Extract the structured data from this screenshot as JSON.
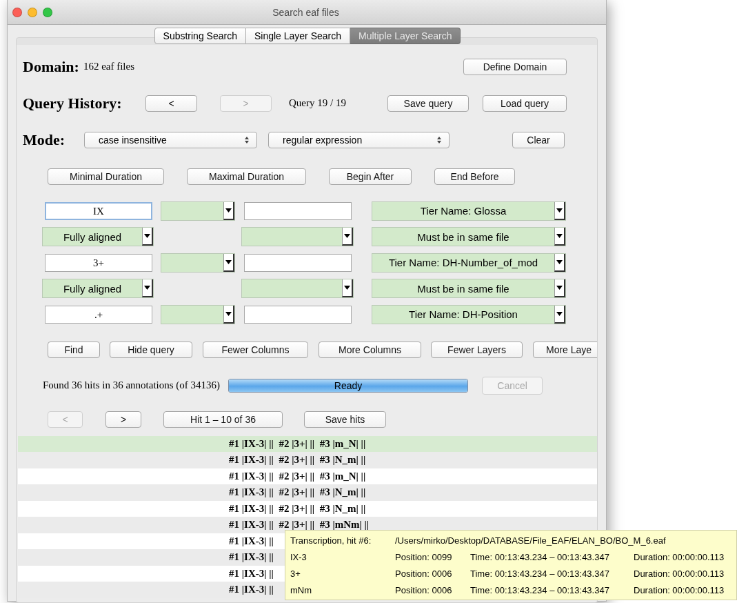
{
  "window": {
    "title": "Search eaf files"
  },
  "tabs": [
    {
      "label": "Substring Search",
      "selected": false
    },
    {
      "label": "Single Layer Search",
      "selected": false
    },
    {
      "label": "Multiple Layer Search",
      "selected": true
    }
  ],
  "domain": {
    "label": "Domain:",
    "value": "162 eaf files",
    "button": "Define Domain"
  },
  "query_history": {
    "label": "Query History:",
    "buttons": [
      {
        "label": "<",
        "disabled": false
      },
      {
        "label": ">",
        "disabled": true
      }
    ],
    "position": "Query 19 / 19",
    "actions": [
      "Save query",
      "Load query"
    ]
  },
  "mode": {
    "label": "Mode:",
    "selects": [
      "case insensitive",
      "regular expression"
    ],
    "button": "Clear"
  },
  "constraints": [
    "Minimal Duration",
    "Maximal Duration",
    "Begin After",
    "End Before"
  ],
  "query_rows": [
    {
      "cells": [
        {
          "kind": "input",
          "value": "IX",
          "focused": true
        },
        {
          "kind": "combo"
        },
        {
          "kind": "input",
          "focused": false
        },
        {
          "kind": "combo",
          "value": "Tier Name: Glossa"
        }
      ]
    },
    {
      "cells": [
        {
          "kind": "combo",
          "value": "Fully aligned"
        },
        {
          "kind": "blank"
        },
        {
          "kind": "combo"
        },
        {
          "kind": "combo",
          "value": "Must be in same file"
        }
      ]
    },
    {
      "cells": [
        {
          "kind": "input",
          "value": "3+",
          "focused": false
        },
        {
          "kind": "combo"
        },
        {
          "kind": "input",
          "focused": false
        },
        {
          "kind": "combo",
          "value": "Tier Name: DH-Number_of_mod"
        }
      ]
    },
    {
      "cells": [
        {
          "kind": "combo",
          "value": "Fully aligned"
        },
        {
          "kind": "blank"
        },
        {
          "kind": "combo"
        },
        {
          "kind": "combo",
          "value": "Must be in same file"
        }
      ]
    },
    {
      "cells": [
        {
          "kind": "input",
          "value": ".+",
          "focused": false
        },
        {
          "kind": "combo"
        },
        {
          "kind": "input",
          "focused": false
        },
        {
          "kind": "combo",
          "value": "Tier Name: DH-Position"
        }
      ]
    }
  ],
  "actions": [
    "Find",
    "Hide query",
    "Fewer Columns",
    "More Columns",
    "Fewer Layers",
    "More Laye"
  ],
  "status": {
    "message": "Found 36 hits in 36 annotations (of 34136)",
    "progress": {
      "label": "Ready",
      "level": 1
    },
    "cancel": {
      "label": "Cancel",
      "disabled": true
    }
  },
  "hits_nav": {
    "prev": {
      "label": "<",
      "disabled": true
    },
    "next": {
      "label": ">",
      "disabled": false
    },
    "range": "Hit 1 – 10 of 36",
    "save": "Save hits"
  },
  "results": [
    {
      "text": "#1 |IX-3| ||  #2 |3+| ||  #3 |m_N| ||",
      "selected": true
    },
    {
      "text": "#1 |IX-3| ||  #2 |3+| ||  #3 |N_m| ||",
      "selected": false
    },
    {
      "text": "#1 |IX-3| ||  #2 |3+| ||  #3 |m_N| ||",
      "selected": false
    },
    {
      "text": "#1 |IX-3| ||  #2 |3+| ||  #3 |N_m| ||",
      "selected": false
    },
    {
      "text": "#1 |IX-3| ||  #2 |3+| ||  #3 |N_m| ||",
      "selected": false
    },
    {
      "text": "#1 |IX-3| ||  #2 |3+| ||  #3 |mNm| ||",
      "selected": false
    },
    {
      "text": "#1 |IX-3| ||",
      "selected": false
    },
    {
      "text": "#1 |IX-3| ||",
      "selected": false
    },
    {
      "text": "#1 |IX-3| ||",
      "selected": false
    },
    {
      "text": "#1 |IX-3| ||",
      "selected": false
    }
  ],
  "tooltip": {
    "title": "Transcription, hit #6:",
    "path": "/Users/mirko/Desktop/DATABASE/File_EAF/ELAN_BO/BO_M_6.eaf",
    "rows": [
      {
        "annotation": "IX-3",
        "position": "Position: 0099",
        "time": "Time: 00:13:43.234 – 00:13:43.347",
        "duration": "Duration: 00:00:00.113"
      },
      {
        "annotation": "3+",
        "position": "Position: 0006",
        "time": "Time: 00:13:43.234 – 00:13:43.347",
        "duration": "Duration: 00:00:00.113"
      },
      {
        "annotation": "mNm",
        "position": "Position: 0006",
        "time": "Time: 00:13:43.234 – 00:13:43.347",
        "duration": "Duration: 00:00:00.113"
      }
    ]
  }
}
